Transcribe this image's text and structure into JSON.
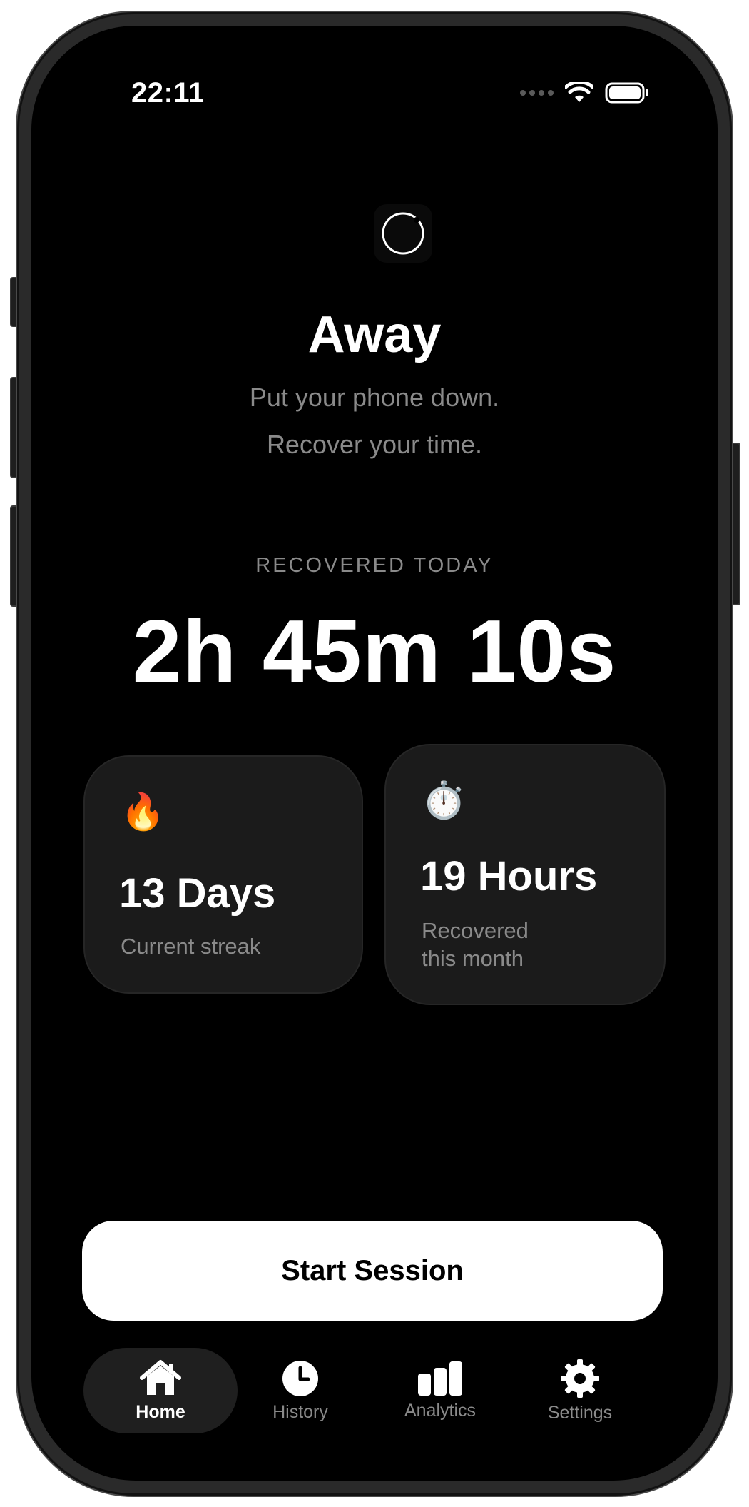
{
  "status_bar": {
    "time": "22:11"
  },
  "app": {
    "title": "Away",
    "tagline_line1": "Put your phone down.",
    "tagline_line2": "Recover your time."
  },
  "recovered_today": {
    "label": "RECOVERED TODAY",
    "value": "2h 45m 10s"
  },
  "cards": {
    "streak": {
      "emoji": "🔥",
      "value": "13 Days",
      "caption": "Current streak"
    },
    "month": {
      "emoji": "⏱️",
      "value": "19 Hours",
      "caption_line1": "Recovered",
      "caption_line2": "this month"
    }
  },
  "actions": {
    "start_session": "Start Session"
  },
  "tabs": [
    {
      "label": "Home",
      "icon": "house-icon",
      "active": true
    },
    {
      "label": "History",
      "icon": "clock-icon",
      "active": false
    },
    {
      "label": "Analytics",
      "icon": "bar-chart-icon",
      "active": false
    },
    {
      "label": "Settings",
      "icon": "gear-icon",
      "active": false
    }
  ],
  "colors": {
    "background": "#000000",
    "card": "#1b1b1b",
    "muted_text": "#8a8a8a",
    "primary_button": "#ffffff"
  }
}
